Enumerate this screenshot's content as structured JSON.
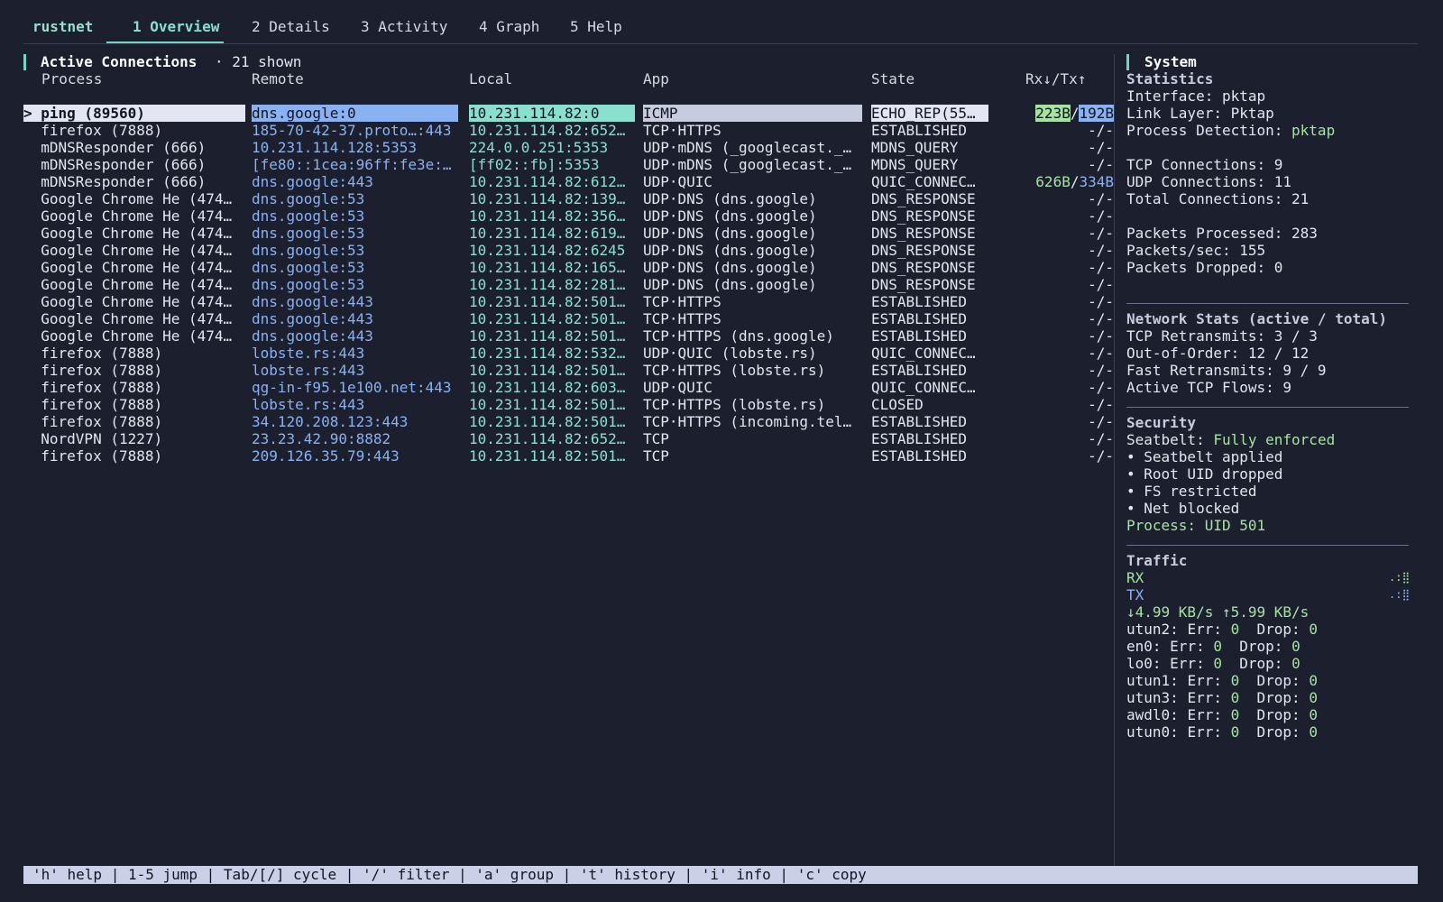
{
  "app": {
    "name": "rustnet"
  },
  "tabs": [
    {
      "label": "1 Overview",
      "active": true
    },
    {
      "label": "2 Details"
    },
    {
      "label": "3 Activity"
    },
    {
      "label": "4 Graph"
    },
    {
      "label": "5 Help"
    }
  ],
  "connections": {
    "title": "Active Connections",
    "count": "· 21 shown",
    "headers": [
      "Process",
      "Remote",
      "Local",
      "App",
      "State",
      "Rx↓/Tx↑"
    ],
    "rows": [
      {
        "selected": true,
        "process": "> ping (89560)",
        "remote": "dns.google:0",
        "local": "10.231.114.82:0",
        "app": "ICMP",
        "state": "ECHO_REP(55…",
        "rx": "223B",
        "tx": "192B"
      },
      {
        "process": "  firefox (7888)",
        "remote": "185-70-42-37.proto…:443",
        "local": "10.231.114.82:652…",
        "app": "TCP·HTTPS",
        "state": "ESTABLISHED",
        "rx": "-",
        "tx": "-"
      },
      {
        "process": "  mDNSResponder (666)",
        "remote": "10.231.114.128:5353",
        "local": "224.0.0.251:5353",
        "app": "UDP·mDNS (_googlecast._…",
        "state": "MDNS_QUERY",
        "rx": "-",
        "tx": "-"
      },
      {
        "process": "  mDNSResponder (666)",
        "remote": "[fe80::1cea:96ff:fe3e:…",
        "local": "[ff02::fb]:5353",
        "app": "UDP·mDNS (_googlecast._…",
        "state": "MDNS_QUERY",
        "rx": "-",
        "tx": "-"
      },
      {
        "process": "  mDNSResponder (666)",
        "remote": "dns.google:443",
        "local": "10.231.114.82:612…",
        "app": "UDP·QUIC",
        "state": "QUIC_CONNEC…",
        "rx": "626B",
        "tx": "334B"
      },
      {
        "process": "  Google Chrome He (474…",
        "remote": "dns.google:53",
        "local": "10.231.114.82:139…",
        "app": "UDP·DNS (dns.google)",
        "state": "DNS_RESPONSE",
        "rx": "-",
        "tx": "-"
      },
      {
        "process": "  Google Chrome He (474…",
        "remote": "dns.google:53",
        "local": "10.231.114.82:356…",
        "app": "UDP·DNS (dns.google)",
        "state": "DNS_RESPONSE",
        "rx": "-",
        "tx": "-"
      },
      {
        "process": "  Google Chrome He (474…",
        "remote": "dns.google:53",
        "local": "10.231.114.82:619…",
        "app": "UDP·DNS (dns.google)",
        "state": "DNS_RESPONSE",
        "rx": "-",
        "tx": "-"
      },
      {
        "process": "  Google Chrome He (474…",
        "remote": "dns.google:53",
        "local": "10.231.114.82:6245",
        "app": "UDP·DNS (dns.google)",
        "state": "DNS_RESPONSE",
        "rx": "-",
        "tx": "-"
      },
      {
        "process": "  Google Chrome He (474…",
        "remote": "dns.google:53",
        "local": "10.231.114.82:165…",
        "app": "UDP·DNS (dns.google)",
        "state": "DNS_RESPONSE",
        "rx": "-",
        "tx": "-"
      },
      {
        "process": "  Google Chrome He (474…",
        "remote": "dns.google:53",
        "local": "10.231.114.82:281…",
        "app": "UDP·DNS (dns.google)",
        "state": "DNS_RESPONSE",
        "rx": "-",
        "tx": "-"
      },
      {
        "process": "  Google Chrome He (474…",
        "remote": "dns.google:443",
        "local": "10.231.114.82:501…",
        "app": "TCP·HTTPS",
        "state": "ESTABLISHED",
        "rx": "-",
        "tx": "-"
      },
      {
        "process": "  Google Chrome He (474…",
        "remote": "dns.google:443",
        "local": "10.231.114.82:501…",
        "app": "TCP·HTTPS",
        "state": "ESTABLISHED",
        "rx": "-",
        "tx": "-"
      },
      {
        "process": "  Google Chrome He (474…",
        "remote": "dns.google:443",
        "local": "10.231.114.82:501…",
        "app": "TCP·HTTPS (dns.google)",
        "state": "ESTABLISHED",
        "rx": "-",
        "tx": "-"
      },
      {
        "process": "  firefox (7888)",
        "remote": "lobste.rs:443",
        "local": "10.231.114.82:532…",
        "app": "UDP·QUIC (lobste.rs)",
        "state": "QUIC_CONNEC…",
        "rx": "-",
        "tx": "-"
      },
      {
        "process": "  firefox (7888)",
        "remote": "lobste.rs:443",
        "local": "10.231.114.82:501…",
        "app": "TCP·HTTPS (lobste.rs)",
        "state": "ESTABLISHED",
        "rx": "-",
        "tx": "-"
      },
      {
        "process": "  firefox (7888)",
        "remote": "qg-in-f95.1e100.net:443",
        "local": "10.231.114.82:603…",
        "app": "UDP·QUIC",
        "state": "QUIC_CONNEC…",
        "rx": "-",
        "tx": "-"
      },
      {
        "process": "  firefox (7888)",
        "remote": "lobste.rs:443",
        "local": "10.231.114.82:501…",
        "app": "TCP·HTTPS (lobste.rs)",
        "state": "CLOSED",
        "rx": "-",
        "tx": "-"
      },
      {
        "process": "  firefox (7888)",
        "remote": "34.120.208.123:443",
        "local": "10.231.114.82:501…",
        "app": "TCP·HTTPS (incoming.tel…",
        "state": "ESTABLISHED",
        "rx": "-",
        "tx": "-"
      },
      {
        "process": "  NordVPN (1227)",
        "remote": "23.23.42.90:8882",
        "local": "10.231.114.82:652…",
        "app": "TCP",
        "state": "ESTABLISHED",
        "rx": "-",
        "tx": "-"
      },
      {
        "process": "  firefox (7888)",
        "remote": "209.126.35.79:443",
        "local": "10.231.114.82:501…",
        "app": "TCP",
        "state": "ESTABLISHED",
        "rx": "-",
        "tx": "-"
      }
    ]
  },
  "system": {
    "title": "System",
    "statistics": {
      "heading": "Statistics",
      "interface_label": "Interface:",
      "interface": "pktap",
      "link_label": "Link Layer:",
      "link": "Pktap",
      "detection_label": "Process Detection:",
      "detection": "pktap",
      "tcp_label": "TCP Connections:",
      "tcp": "9",
      "udp_label": "UDP Connections:",
      "udp": "11",
      "total_label": "Total Connections:",
      "total": "21",
      "pp_label": "Packets Processed:",
      "pp": "283",
      "ps_label": "Packets/sec:",
      "ps": "155",
      "pd_label": "Packets Dropped:",
      "pd": "0"
    },
    "network": {
      "heading": "Network Stats (active / total)",
      "lines": [
        "TCP Retransmits: 3 / 3",
        "Out-of-Order: 12 / 12",
        "Fast Retransmits: 9 / 9",
        "Active TCP Flows: 9"
      ]
    },
    "security": {
      "heading": "Security",
      "seatbelt_label": "Seatbelt:",
      "seatbelt": "Fully enforced",
      "bullets": [
        "• Seatbelt applied",
        "• Root UID dropped",
        "• FS restricted",
        "• Net blocked"
      ],
      "process": "Process: UID 501"
    },
    "traffic": {
      "heading": "Traffic",
      "rx_label": "RX",
      "tx_label": "TX",
      "rx_spark": ".:⣿",
      "tx_spark": ".:⣿",
      "rates": "↓4.99 KB/s ↑5.99 KB/s",
      "interfaces": [
        {
          "name": "utun2:",
          "err": "0",
          "drop": "0"
        },
        {
          "name": "en0:",
          "err": "0",
          "drop": "0"
        },
        {
          "name": "lo0:",
          "err": "0",
          "drop": "0"
        },
        {
          "name": "utun1:",
          "err": "0",
          "drop": "0"
        },
        {
          "name": "utun3:",
          "err": "0",
          "drop": "0"
        },
        {
          "name": "awdl0:",
          "err": "0",
          "drop": "0"
        },
        {
          "name": "utun0:",
          "err": "0",
          "drop": "0"
        }
      ],
      "err_label": "Err:",
      "drop_label": "Drop:"
    }
  },
  "footer": {
    "hint": "'h' help | 1-5 jump | Tab/[/] cycle | '/' filter | 'a' group | 't' history | 'i' info | 'c' copy"
  },
  "colors": {
    "background": "#1c1f2e",
    "accent_teal": "#6fd6c8",
    "remote_blue": "#8ab1f2",
    "local_teal": "#89e0cf",
    "green": "#a6e3a1",
    "footer_bg": "#c9d0e8"
  }
}
